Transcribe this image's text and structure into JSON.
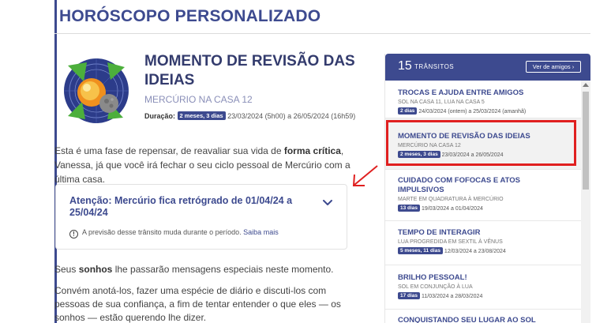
{
  "header": {
    "title": "HORÓSCOPO PERSONALIZADO"
  },
  "transit": {
    "title": "MOMENTO DE REVISÃO DAS IDEIAS",
    "subtitle": "MERCÚRIO NA CASA 12",
    "duration_label": "Duração:",
    "duration_badge": "2 meses, 3 dias",
    "duration_range": "23/03/2024 (5h00) a 26/05/2024 (16h59)"
  },
  "intro": {
    "before": "Esta é uma fase de repensar, de reavaliar sua vida de ",
    "bold": "forma crítica",
    "after": ", Vanessa, já que você irá fechar o seu ciclo pessoal de Mercúrio com a última casa."
  },
  "alert": {
    "title": "Atenção: Mercúrio fica retrógrado de 01/04/24 a 25/04/24",
    "note": "A previsão desse trânsito muda durante o período.",
    "link": "Saiba mais",
    "info_icon": "info-icon",
    "toggle_icon": "chevron-down-icon"
  },
  "body": {
    "p2_before": "Seus ",
    "p2_bold": "sonhos",
    "p2_after": " lhe passarão mensagens especiais neste momento.",
    "p3": "Convém anotá-los, fazer uma espécie de diário e discuti-los com pessoas de sua confiança, a fim de tentar entender o que eles — os sonhos — estão querendo lhe dizer."
  },
  "sidebar": {
    "count": "15",
    "label": "TRÂNSITOS",
    "friends_button": "Ver de amigos ›",
    "items": [
      {
        "title": "TROCAS E AJUDA ENTRE AMIGOS",
        "sub": "SOL NA CASA 11, LUA NA CASA 5",
        "badge": "2 dias",
        "range": "24/03/2024 (ontem) a 25/03/2024 (amanhã)"
      },
      {
        "title": "MOMENTO DE REVISÃO DAS IDEIAS",
        "sub": "MERCÚRIO NA CASA 12",
        "badge": "2 meses, 3 dias",
        "range": "23/03/2024 a 26/05/2024"
      },
      {
        "title": "CUIDADO COM FOFOCAS E ATOS IMPULSIVOS",
        "sub": "MARTE EM QUADRATURA À MERCÚRIO",
        "badge": "13 dias",
        "range": "19/03/2024 a 01/04/2024"
      },
      {
        "title": "TEMPO DE INTERAGIR",
        "sub": "LUA PROGREDIDA EM SEXTIL À VÊNUS",
        "badge": "5 meses, 11 dias",
        "range": "12/03/2024 a 23/08/2024"
      },
      {
        "title": "BRILHO PESSOAL!",
        "sub": "SOL EM CONJUNÇÃO À LUA",
        "badge": "17 dias",
        "range": "11/03/2024 a 28/03/2024"
      },
      {
        "title": "CONQUISTANDO SEU LUGAR AO SOL",
        "sub": "",
        "badge": "",
        "range": ""
      }
    ]
  }
}
